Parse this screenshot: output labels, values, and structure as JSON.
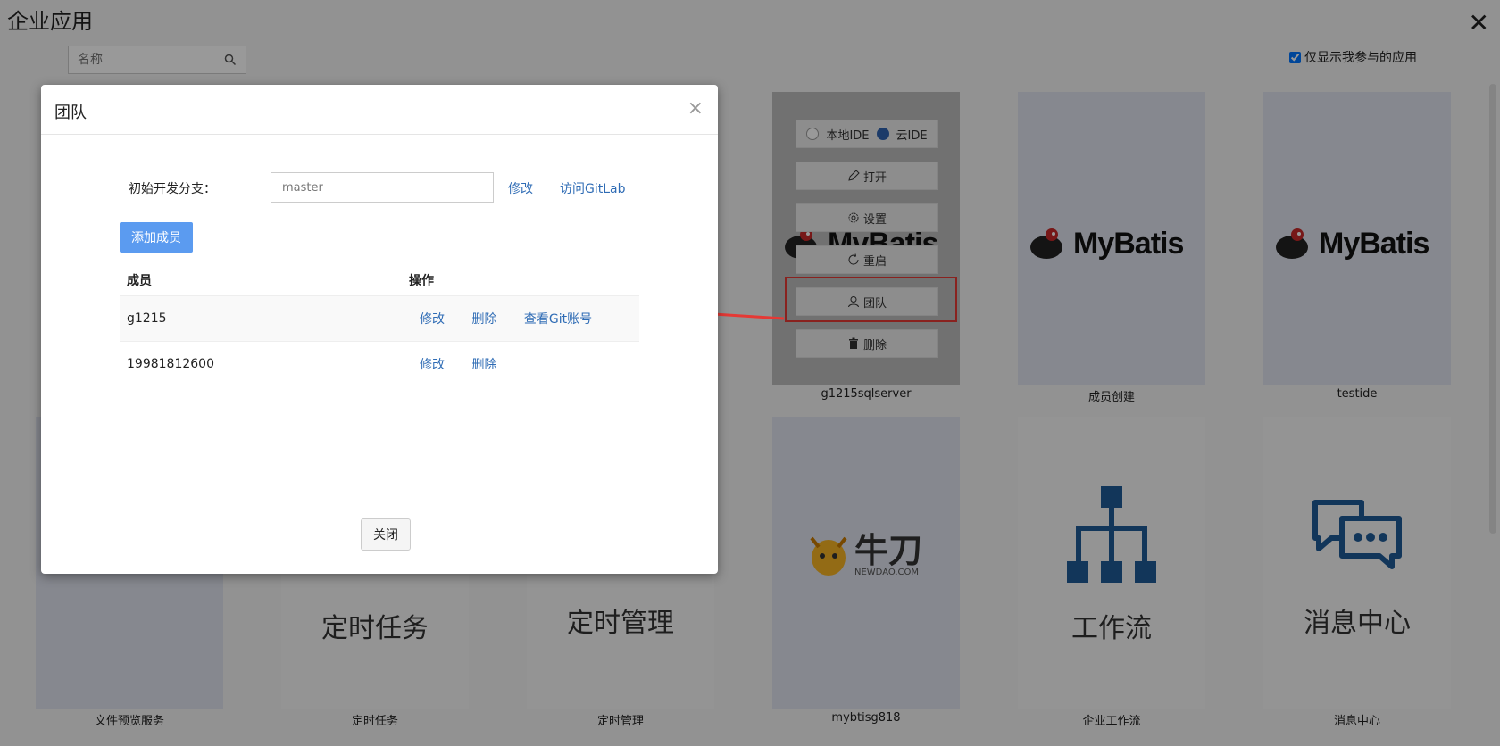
{
  "page": {
    "title": "企业应用",
    "search_placeholder": "名称",
    "only_mine_label": "仅显示我参与的应用"
  },
  "hover_menu": {
    "local_ide": "本地IDE",
    "cloud_ide": "云IDE",
    "open": "打开",
    "settings": "设置",
    "restart": "重启",
    "team": "团队",
    "delete": "删除"
  },
  "cards": [
    {
      "label": "g1215sqlserver",
      "logo": "MyBatis"
    },
    {
      "label": "成员创建",
      "logo": "MyBatis"
    },
    {
      "label": "testide",
      "logo": "MyBatis"
    },
    {
      "label": "文件预览服务"
    },
    {
      "label": "定时任务",
      "text": "定时任务"
    },
    {
      "label": "定时管理",
      "text": "定时管理"
    },
    {
      "label": "mybtisg818",
      "logo": "牛刀",
      "logo_sub": "NEWDAO.COM"
    },
    {
      "label": "企业工作流",
      "text": "工作流"
    },
    {
      "label": "消息中心",
      "text": "消息中心"
    }
  ],
  "modal": {
    "title": "团队",
    "branch_label": "初始开发分支：",
    "branch_value": "master",
    "edit_link": "修改",
    "gitlab_link": "访问GitLab",
    "add_member": "添加成员",
    "col_member": "成员",
    "col_ops": "操作",
    "rows": [
      {
        "member": "g1215",
        "edit": "修改",
        "delete": "删除",
        "git": "查看Git账号"
      },
      {
        "member": "19981812600",
        "edit": "修改",
        "delete": "删除"
      }
    ],
    "close": "关闭"
  },
  "colors": {
    "accent": "#2f6cb5",
    "primary_button": "#5b9bf0",
    "highlight": "#e53935"
  }
}
